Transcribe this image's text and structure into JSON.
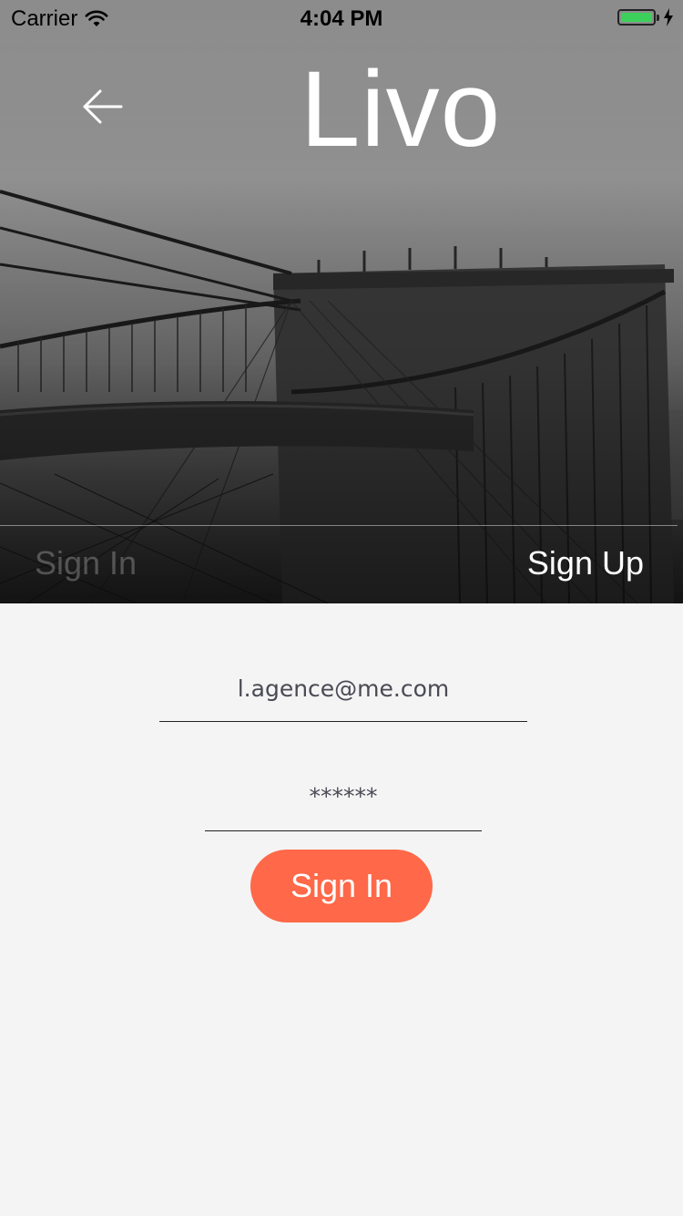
{
  "status_bar": {
    "carrier": "Carrier",
    "time": "4:04 PM",
    "battery_color": "#3cd05b"
  },
  "header": {
    "back_icon": "arrow-left-icon",
    "title": "Livo"
  },
  "tabs": [
    {
      "label": "Sign In",
      "active": false
    },
    {
      "label": "Sign Up",
      "active": true
    }
  ],
  "form": {
    "email_value": "l.agence@me.com",
    "password_value": "******",
    "submit_label": "Sign In"
  },
  "colors": {
    "accent": "#ff6848",
    "background": "#f4f4f4",
    "text": "#4a4a55"
  }
}
